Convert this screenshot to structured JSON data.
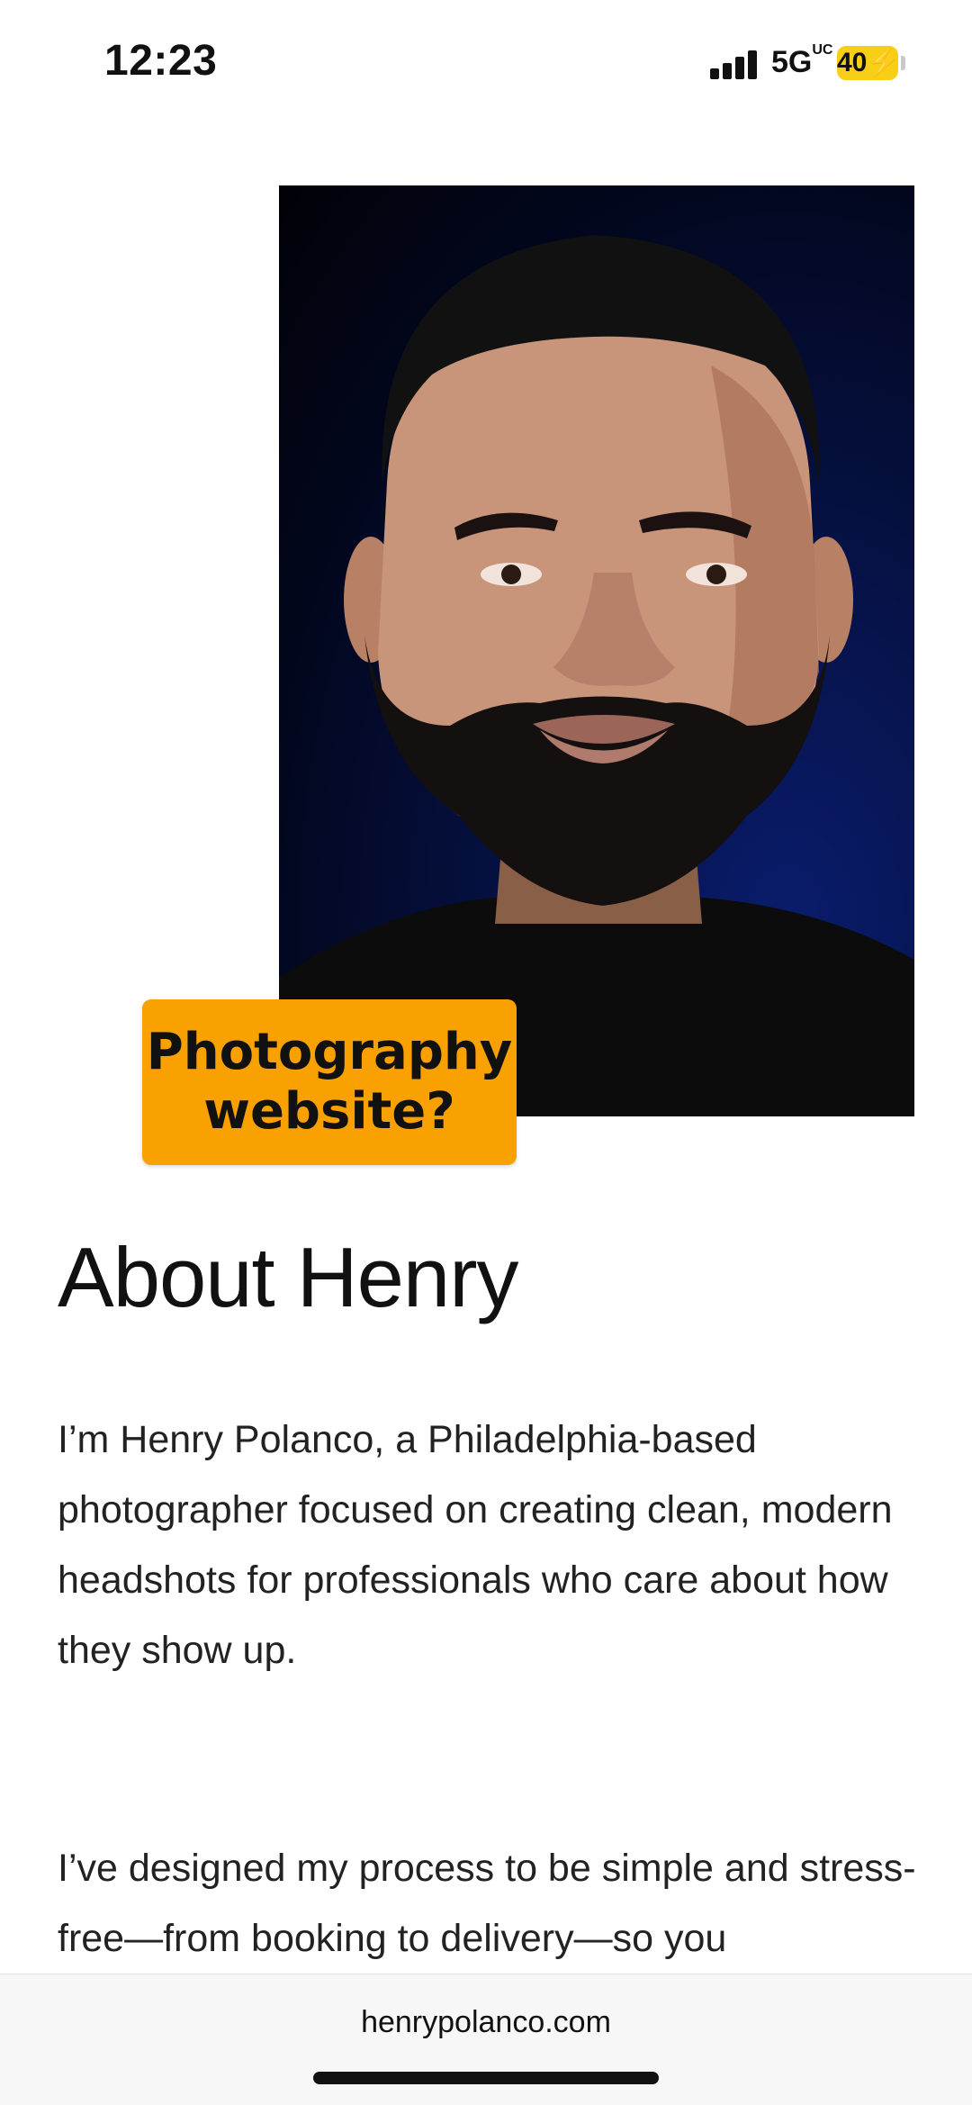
{
  "status_bar": {
    "time": "12:23",
    "network": "5G",
    "network_suffix": "UC",
    "battery": "40"
  },
  "hero": {
    "image_alt": "Portrait of Henry Polanco",
    "tag_text": "Photography\nwebsite?",
    "tag_color": "#f8a100"
  },
  "about": {
    "heading": "About Henry",
    "paragraph_1": "I’m Henry Polanco, a Philadelphia-based photographer focused on creating clean, modern headshots for professionals who care about how they show up.",
    "paragraph_2": "I’ve designed my process to be simple and stress-free—from booking to delivery—so you"
  },
  "browser": {
    "url": "henrypolanco.com"
  }
}
